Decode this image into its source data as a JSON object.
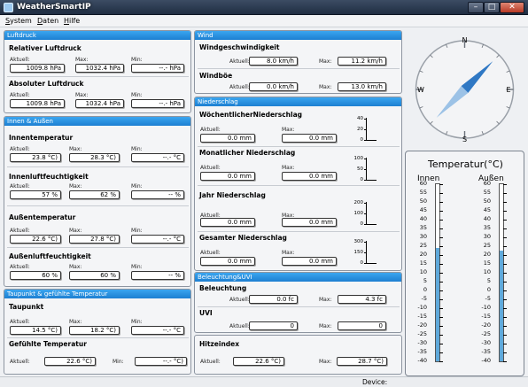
{
  "window": {
    "title": "WeatherSmartIP"
  },
  "menu": {
    "items": [
      {
        "label": "System",
        "underline": "S",
        "rest": "ystem"
      },
      {
        "label": "Daten",
        "underline": "D",
        "rest": "aten"
      },
      {
        "label": "Hilfe",
        "underline": "H",
        "rest": "ilfe"
      }
    ]
  },
  "labels": {
    "aktuell": "Aktuell:",
    "max": "Max:",
    "min": "Min:"
  },
  "luftdruck": {
    "header": "Luftdruck",
    "relativ": {
      "title": "Relativer Luftdruck",
      "aktuell": "1009.8 hPa",
      "max": "1032.4 hPa",
      "min": "--.- hPa"
    },
    "absolut": {
      "title": "Absoluter Luftdruck",
      "aktuell": "1009.8 hPa",
      "max": "1032.4 hPa",
      "min": "--.- hPa"
    }
  },
  "innen_aussen": {
    "header": "Innen & Außen",
    "innentemp": {
      "title": "Innentemperatur",
      "aktuell": "23.8 °C)",
      "max": "28.3 °C)",
      "min": "--.- °C"
    },
    "innenfeuchte": {
      "title": "Innenluftfeuchtigkeit",
      "aktuell": "57 %",
      "max": "62 %",
      "min": "-- %"
    },
    "aussentemp": {
      "title": "Außentemperatur",
      "aktuell": "22.6 °C)",
      "max": "27.8 °C)",
      "min": "--.- °C"
    },
    "aussenfeuchte": {
      "title": "Außenluftfeuchtigkeit",
      "aktuell": "60 %",
      "max": "60 %",
      "min": "-- %"
    }
  },
  "taupunkt": {
    "header": "Taupunkt & gefühlte Temperatur",
    "taupunkt": {
      "title": "Taupunkt",
      "aktuell": "14.5 °C)",
      "max": "18.2 °C)",
      "min": "--.- °C"
    },
    "gefuehlt": {
      "title": "Gefühlte Temperatur",
      "aktuell": "22.6 °C)",
      "min": "--.- °C)"
    }
  },
  "wind": {
    "header": "Wind",
    "geschw": {
      "title": "Windgeschwindigkeit",
      "aktuell": "8.0 km/h",
      "max": "11.2 km/h"
    },
    "boee": {
      "title": "Windböe",
      "aktuell": "0.0 km/h",
      "max": "13.0 km/h"
    }
  },
  "niederschlag": {
    "header": "Niederschlag",
    "woche": {
      "title": "WöchentlicherNiederschlag",
      "aktuell": "0.0 mm",
      "max": "0.0 mm",
      "ticks": [
        "40",
        "20",
        "0"
      ]
    },
    "monat": {
      "title": "Monatlicher Niederschlag",
      "aktuell": "0.0 mm",
      "max": "0.0 mm",
      "ticks": [
        "100",
        "50",
        "0"
      ]
    },
    "jahr": {
      "title": "Jahr Niederschlag",
      "aktuell": "0.0 mm",
      "max": "0.0 mm",
      "ticks": [
        "200",
        "100",
        "0"
      ]
    },
    "gesamt": {
      "title": "Gesamter Niederschlag",
      "aktuell": "0.0 mm",
      "max": "0.0 mm",
      "ticks": [
        "300",
        "150",
        "0"
      ]
    }
  },
  "beleuchtung": {
    "header": "Beleuchtung&UVI",
    "licht": {
      "title": "Beleuchtung",
      "aktuell": "0.0 fc",
      "max": "4.3 fc"
    },
    "uvi": {
      "title": "UVI",
      "aktuell": "0",
      "max": "0"
    }
  },
  "hitze": {
    "title": "Hitzeindex",
    "aktuell": "22.6 °C)",
    "max": "28.7 °C)"
  },
  "compass": {
    "north": "N",
    "east": "E",
    "south": "S",
    "west": "W",
    "direction_deg": 45
  },
  "thermometer": {
    "title": "Temperatur(°C)",
    "innen_label": "Innen",
    "aussen_label": "Außen",
    "scale": [
      "60",
      "55",
      "50",
      "45",
      "40",
      "35",
      "30",
      "25",
      "20",
      "15",
      "10",
      "5",
      "0",
      "-5",
      "-10",
      "-15",
      "-20",
      "-25",
      "-30",
      "-35",
      "-40"
    ],
    "innen_value": 23.8,
    "aussen_value": 22.6,
    "range": [
      -40,
      60
    ]
  },
  "status": {
    "device": "Device:"
  },
  "colors": {
    "header_blue": "#2b90e0",
    "thermo_fill": "#5fa9db",
    "compass_needle": "#2f78c4"
  }
}
